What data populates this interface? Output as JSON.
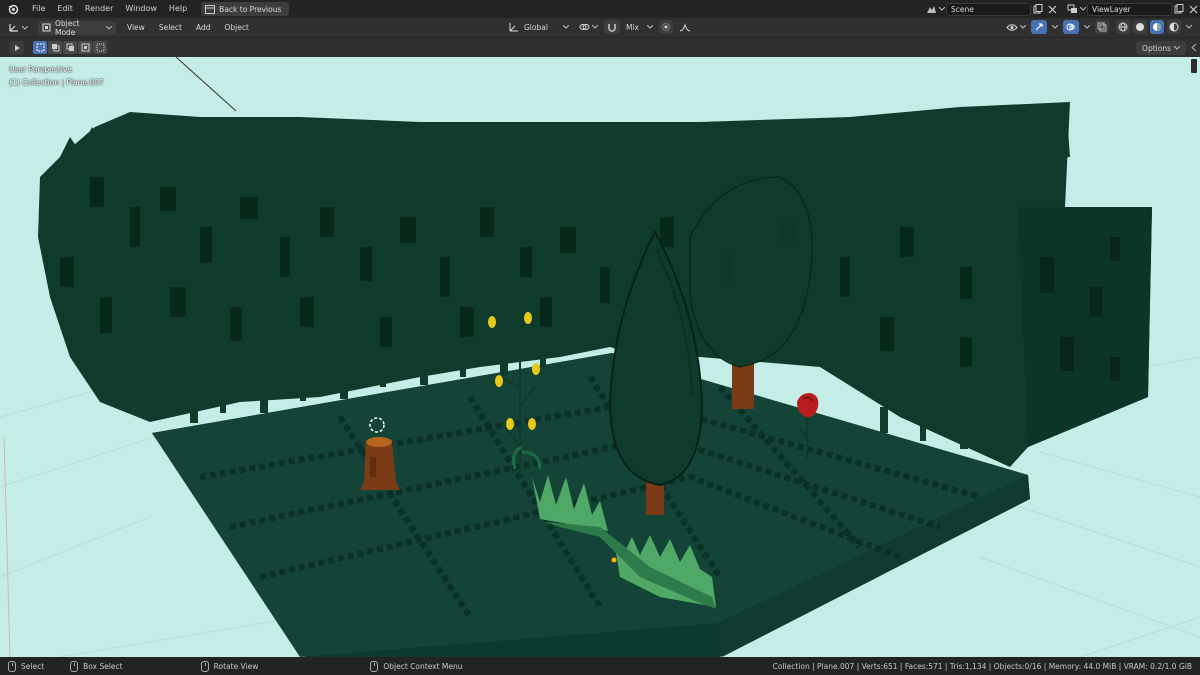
{
  "topbar": {
    "menus": [
      "File",
      "Edit",
      "Render",
      "Window",
      "Help"
    ],
    "back_button": "Back to Previous",
    "scene_name": "Scene",
    "view_layer": "ViewLayer"
  },
  "header": {
    "mode": "Object Mode",
    "menus": [
      "View",
      "Select",
      "Add",
      "Object"
    ],
    "transform_orientation": "Global",
    "proportional": "Mix"
  },
  "toolheader": {
    "options_label": "Options"
  },
  "viewport": {
    "view_name": "User Perspective",
    "collection_info": "(1) Collection | Plane.007",
    "colors": {
      "background": "#c4ede8",
      "foliage": "#0e3b2c",
      "foliage_dark": "#08241b",
      "ground": "#134437",
      "trunk": "#7a3b16",
      "grass": "#4fa865",
      "rose": "#b81d1d",
      "flower_yellow": "#e8c81a"
    }
  },
  "statusbar": {
    "select": "Select",
    "box_select": "Box Select",
    "rotate_view": "Rotate View",
    "context_menu": "Object Context Menu",
    "stats": "Collection | Plane.007 | Verts:651 | Faces:571 | Tris:1,134 | Objects:0/16 | Memory: 44.0 MiB | VRAM: 0.2/1.0 GiB"
  }
}
